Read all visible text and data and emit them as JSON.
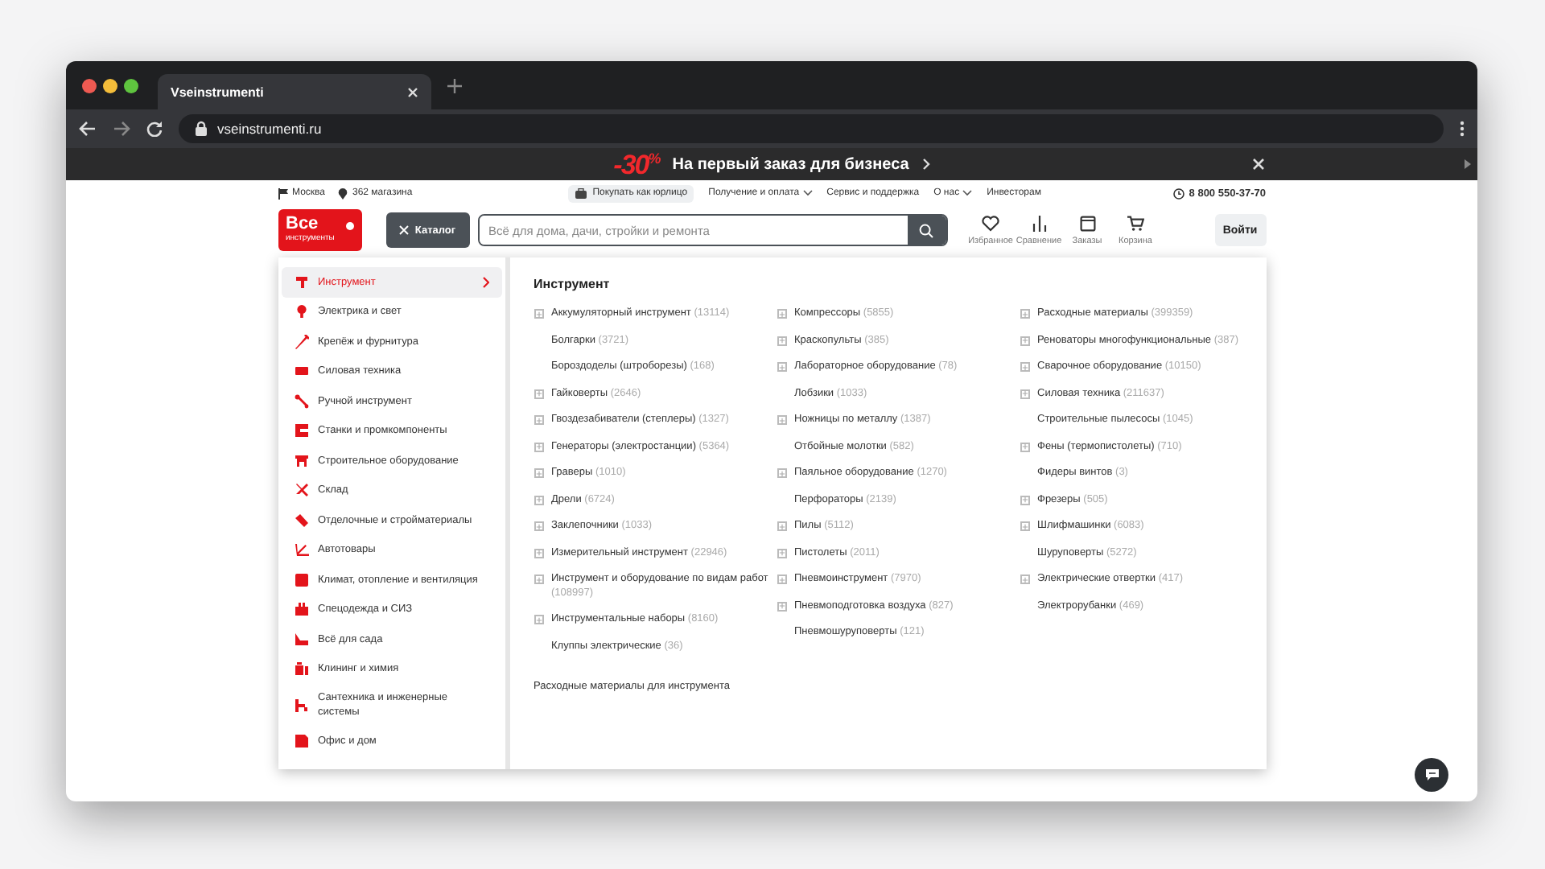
{
  "browser": {
    "tab_title": "Vseinstrumenti",
    "url": "vseinstrumenti.ru"
  },
  "promo": {
    "discount": "-30$^{%}$",
    "text": "На первый заказ для бизнеса"
  },
  "top_bar": {
    "city": "Москва",
    "stores": "362 магазина",
    "phone": "8 800 550-37-70",
    "links": [
      {
        "label": "Покупать как юрлицо",
        "kind": "pill"
      },
      {
        "label": "Получение и оплата",
        "kind": "dropdown"
      },
      {
        "label": "Сервис и поддержка",
        "kind": "plain"
      },
      {
        "label": "О нас",
        "kind": "dropdown"
      },
      {
        "label": "Инвесторам",
        "kind": "plain"
      }
    ]
  },
  "header": {
    "logo": {
      "line1": "Все",
      "line2": "инструменты"
    },
    "catalog_button": "Каталог",
    "search": {
      "placeholder": "Всё для дома, дачи, стройки и ремонта"
    },
    "actions": [
      {
        "label": "Избранное",
        "kind": "heart"
      },
      {
        "label": "Сравнение",
        "kind": "bars"
      },
      {
        "label": "Заказы",
        "kind": "box"
      },
      {
        "label": "Корзина",
        "kind": "cart"
      }
    ],
    "login_button": "Войти"
  },
  "catalog": {
    "categories": [
      {
        "label": "Инструмент",
        "selected": true
      },
      {
        "label": "Электрика и свет",
        "selected": false
      },
      {
        "label": "Крепёж и фурнитура",
        "selected": false
      },
      {
        "label": "Силовая техника",
        "selected": false
      },
      {
        "label": "Ручной инструмент",
        "selected": false
      },
      {
        "label": "Станки и промкомпоненты",
        "selected": false
      },
      {
        "label": "Строительное оборудование",
        "selected": false
      },
      {
        "label": "Склад",
        "selected": false
      },
      {
        "label": "Отделочные и стройматериалы",
        "selected": false
      },
      {
        "label": "Автотовары",
        "selected": false
      },
      {
        "label": "Климат, отопление и вентиляция",
        "selected": false
      },
      {
        "label": "Спецодежда и СИЗ",
        "selected": false
      },
      {
        "label": "Всё для сада",
        "selected": false
      },
      {
        "label": "Клининг и химия",
        "selected": false
      },
      {
        "label": "Сантехника и инженерные системы",
        "selected": false
      },
      {
        "label": "Офис и дом",
        "selected": false
      }
    ],
    "section_title": "Инструмент",
    "columns": [
      [
        {
          "label": "Аккумуляторный инструмент",
          "count": "(13114)",
          "expandable": true
        },
        {
          "label": "Болгарки",
          "count": "(3721)",
          "expandable": false
        },
        {
          "label": "Бороздоделы (штроборезы)",
          "count": "(168)",
          "expandable": false
        },
        {
          "label": "Гайковерты",
          "count": "(2646)",
          "expandable": true
        },
        {
          "label": "Гвоздезабиватели (степлеры)",
          "count": "(1327)",
          "expandable": true
        },
        {
          "label": "Генераторы (электростанции)",
          "count": "(5364)",
          "expandable": true
        },
        {
          "label": "Граверы",
          "count": "(1010)",
          "expandable": true
        },
        {
          "label": "Дрели",
          "count": "(6724)",
          "expandable": true
        },
        {
          "label": "Заклепочники",
          "count": "(1033)",
          "expandable": true
        },
        {
          "label": "Измерительный инструмент",
          "count": "(22946)",
          "expandable": true
        },
        {
          "label": "Инструмент и оборудование по видам работ",
          "count": "(108997)",
          "expandable": true
        },
        {
          "label": "Инструментальные наборы",
          "count": "(8160)",
          "expandable": true
        },
        {
          "label": "Клуппы электрические",
          "count": "(36)",
          "expandable": false
        }
      ],
      [
        {
          "label": "Компрессоры",
          "count": "(5855)",
          "expandable": true
        },
        {
          "label": "Краскопульты",
          "count": "(385)",
          "expandable": true
        },
        {
          "label": "Лабораторное оборудование",
          "count": "(78)",
          "expandable": true
        },
        {
          "label": "Лобзики",
          "count": "(1033)",
          "expandable": false
        },
        {
          "label": "Ножницы по металлу",
          "count": "(1387)",
          "expandable": true
        },
        {
          "label": "Отбойные молотки",
          "count": "(582)",
          "expandable": false
        },
        {
          "label": "Паяльное оборудование",
          "count": "(1270)",
          "expandable": true
        },
        {
          "label": "Перфораторы",
          "count": "(2139)",
          "expandable": false
        },
        {
          "label": "Пилы",
          "count": "(5112)",
          "expandable": true
        },
        {
          "label": "Пистолеты",
          "count": "(2011)",
          "expandable": true
        },
        {
          "label": "Пневмоинструмент",
          "count": "(7970)",
          "expandable": true
        },
        {
          "label": "Пневмоподготовка воздуха",
          "count": "(827)",
          "expandable": true
        },
        {
          "label": "Пневмошуруповерты",
          "count": "(121)",
          "expandable": false
        }
      ],
      [
        {
          "label": "Расходные материалы",
          "count": "(399359)",
          "expandable": true
        },
        {
          "label": "Реноваторы многофункциональные",
          "count": "(387)",
          "expandable": true
        },
        {
          "label": "Сварочное оборудование",
          "count": "(10150)",
          "expandable": true
        },
        {
          "label": "Силовая техника",
          "count": "(211637)",
          "expandable": true
        },
        {
          "label": "Строительные пылесосы",
          "count": "(1045)",
          "expandable": false
        },
        {
          "label": "Фены (термопистолеты)",
          "count": "(710)",
          "expandable": true
        },
        {
          "label": "Фидеры винтов",
          "count": "(3)",
          "expandable": false
        },
        {
          "label": "Фрезеры",
          "count": "(505)",
          "expandable": true
        },
        {
          "label": "Шлифмашинки",
          "count": "(6083)",
          "expandable": true
        },
        {
          "label": "Шуруповерты",
          "count": "(5272)",
          "expandable": false
        },
        {
          "label": "Электрические отвертки",
          "count": "(417)",
          "expandable": true
        },
        {
          "label": "Электрорубанки",
          "count": "(469)",
          "expandable": false
        }
      ]
    ],
    "footer_link": "Расходные материалы для инструмента"
  }
}
